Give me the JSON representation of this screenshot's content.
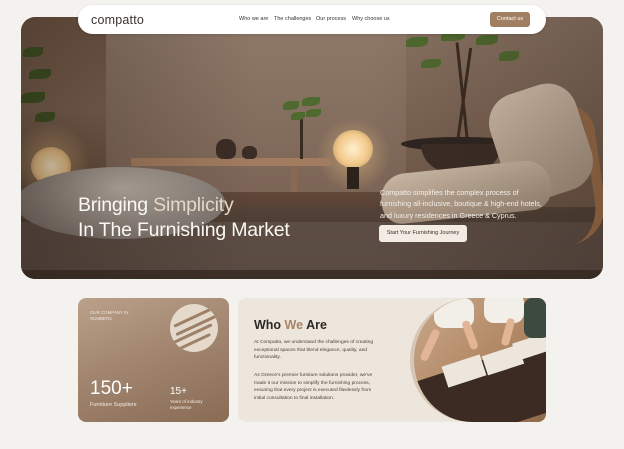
{
  "nav": {
    "logo": "compatto",
    "links": [
      "Who we are",
      "The challenges",
      "Our process",
      "Why choose us"
    ],
    "cta": "Contact us"
  },
  "hero": {
    "title_line1_pre": "Bringing ",
    "title_line1_accent": "Simplicity",
    "title_line2": "In The Furnishing Market",
    "description": "Compatto simplifies the complex process of furnishing all-inclusive, boutique & high-end hotels, and luxury residences in Greece & Cyprus.",
    "cta": "Start Your Furnishing Journey"
  },
  "stats": {
    "eyebrow": "OUR COMPANY IN NUMBERS",
    "primary_value": "150+",
    "primary_label": "Furniture Suppliers",
    "secondary_value": "15+",
    "secondary_label": "Years of industry experience"
  },
  "who": {
    "title_pre": "Who ",
    "title_accent": "We",
    "title_post": " Are",
    "paragraph1": "At Compatto, we understand the challenges of creating exceptional spaces that blend elegance, quality, and functionality.",
    "paragraph2": "As Greece's premier furniture solutions provider, we've made it our mission to simplify the furnishing process, ensuring that every project is executed flawlessly from initial consultation to final installation."
  },
  "colors": {
    "accent": "#a17f62",
    "background": "#f4f2ee",
    "card": "#ede6dd"
  }
}
